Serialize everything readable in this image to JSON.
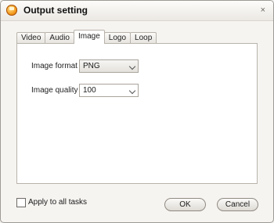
{
  "window": {
    "title": "Output setting",
    "close_glyph": "×",
    "app_icon": "app-logo-icon"
  },
  "tabs": [
    {
      "label": "Video",
      "active": false
    },
    {
      "label": "Audio",
      "active": false
    },
    {
      "label": "Image",
      "active": true
    },
    {
      "label": "Logo",
      "active": false
    },
    {
      "label": "Loop",
      "active": false
    }
  ],
  "image_settings": {
    "format_label": "Image format",
    "format_value": "PNG",
    "quality_label": "Image quality",
    "quality_value": "100"
  },
  "footer": {
    "apply_all_label": "Apply to all tasks",
    "apply_all_checked": false,
    "ok_label": "OK",
    "cancel_label": "Cancel"
  },
  "colors": {
    "title_bar": "#ebe8e3",
    "panel_bg": "#ffffff",
    "accent_icon": "#f39a1d"
  }
}
